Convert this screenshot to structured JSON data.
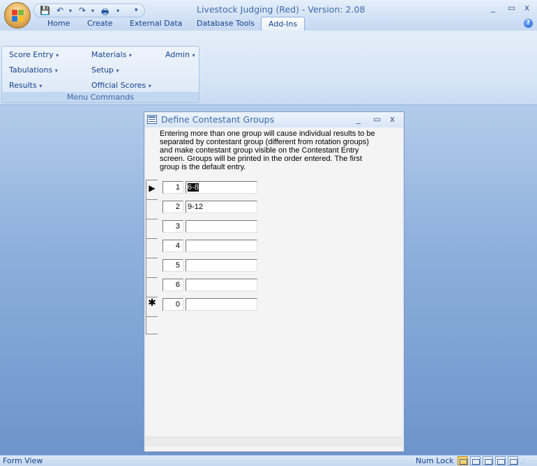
{
  "window": {
    "title": "Livestock Judging (Red) - Version: 2.08",
    "minimize": "_",
    "maximize": "▭",
    "close": "x"
  },
  "qat": {
    "undo": "↶",
    "redo": "↷",
    "customize": "▾"
  },
  "tabs": [
    {
      "label": "Home"
    },
    {
      "label": "Create"
    },
    {
      "label": "External Data"
    },
    {
      "label": "Database Tools"
    },
    {
      "label": "Add-Ins",
      "active": true
    }
  ],
  "ribbon": {
    "group_label": "Menu Commands",
    "menus": [
      {
        "label": "Score Entry"
      },
      {
        "label": "Materials"
      },
      {
        "label": "Admin"
      },
      {
        "label": "Tabulations"
      },
      {
        "label": "Setup"
      },
      {
        "label": "Results"
      },
      {
        "label": "Official Scores"
      }
    ],
    "dropdown_arrow": "▾"
  },
  "dialog": {
    "title": "Define Contestant Groups",
    "minimize": "_",
    "maximize": "▭",
    "close": "x",
    "description": "Entering more than one group will cause individual results to be separated by contestant group (different from rotation groups) and make contestant group visible on the Contestant Entry screen. Groups will be printed in the order entered.  The first group is the default entry.",
    "rows": [
      {
        "selector": "▶",
        "number": "1",
        "group": "6-8",
        "selected": true
      },
      {
        "selector": "",
        "number": "2",
        "group": "9-12"
      },
      {
        "selector": "",
        "number": "3",
        "group": ""
      },
      {
        "selector": "",
        "number": "4",
        "group": ""
      },
      {
        "selector": "",
        "number": "5",
        "group": ""
      },
      {
        "selector": "",
        "number": "6",
        "group": ""
      },
      {
        "selector": "✱",
        "number": "0",
        "group": ""
      }
    ]
  },
  "status": {
    "view_mode": "Form View",
    "num_lock": "Num Lock"
  },
  "colors": {
    "accent": "#15428b",
    "ribbon_bg": "#d5e4f6",
    "workspace": "#8eb0dc"
  }
}
